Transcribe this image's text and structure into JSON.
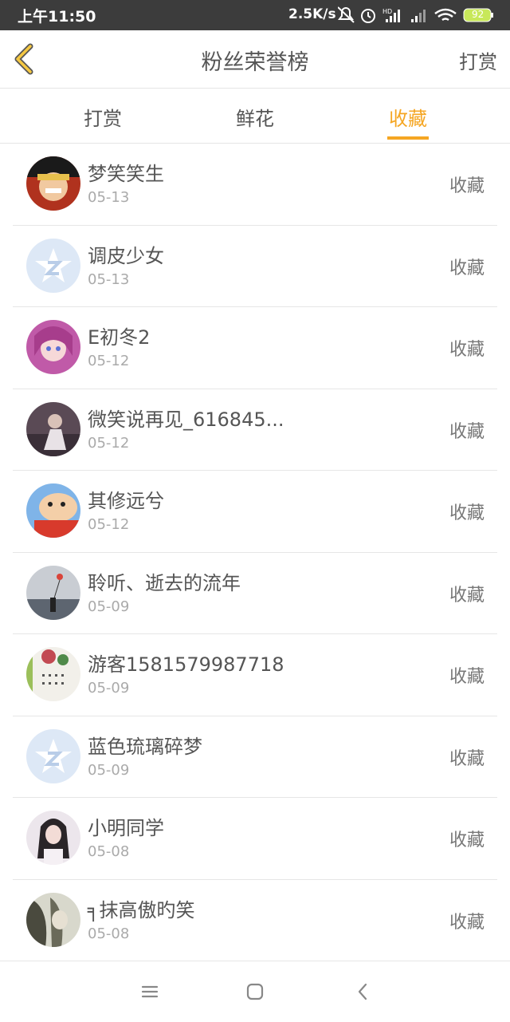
{
  "status_bar": {
    "time": "上午11:50",
    "network_speed": "2.5K/s",
    "battery": "92"
  },
  "nav": {
    "back_icon": "chevron-left-icon",
    "title": "粉丝荣誉榜",
    "right_label": "打赏"
  },
  "tabs": [
    {
      "label": "打赏",
      "active": false
    },
    {
      "label": "鲜花",
      "active": false
    },
    {
      "label": "收藏",
      "active": true
    }
  ],
  "fans": [
    {
      "name": "梦笑笑生",
      "date": "05-13",
      "action": "收藏",
      "avatar": "anime-boy"
    },
    {
      "name": "调皮少女",
      "date": "05-13",
      "action": "收藏",
      "avatar": "default"
    },
    {
      "name": "E初冬2",
      "date": "05-12",
      "action": "收藏",
      "avatar": "anime-girl"
    },
    {
      "name": "微笑说再见_616845...",
      "date": "05-12",
      "action": "收藏",
      "avatar": "photo-dark"
    },
    {
      "name": "其修远兮",
      "date": "05-12",
      "action": "收藏",
      "avatar": "cartoon"
    },
    {
      "name": "聆听、逝去的流年",
      "date": "05-09",
      "action": "收藏",
      "avatar": "sea"
    },
    {
      "name": "游客1581579987718",
      "date": "05-09",
      "action": "收藏",
      "avatar": "art"
    },
    {
      "name": "蓝色琉璃碎梦",
      "date": "05-09",
      "action": "收藏",
      "avatar": "default"
    },
    {
      "name": "小明同学",
      "date": "05-08",
      "action": "收藏",
      "avatar": "girl"
    },
    {
      "name": "╕抹高傲旳笑",
      "date": "05-08",
      "action": "收藏",
      "avatar": "gray"
    }
  ],
  "colors": {
    "accent": "#f5a623",
    "text": "#555555",
    "muted": "#aaaaaa"
  }
}
